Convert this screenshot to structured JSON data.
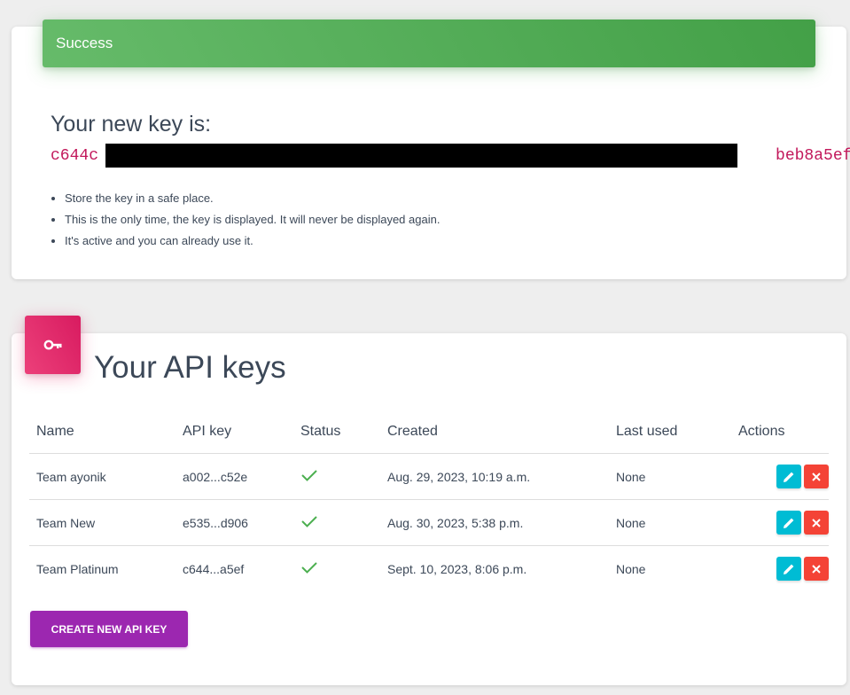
{
  "success": {
    "banner": "Success",
    "heading": "Your new key is:",
    "key_prefix": "c644c",
    "key_suffix": "beb8a5ef",
    "notes": [
      "Store the key in a safe place.",
      "This is the only time, the key is displayed. It will never be displayed again.",
      "It's active and you can already use it."
    ]
  },
  "keys": {
    "title": "Your API keys",
    "icon": "key-icon",
    "columns": [
      "Name",
      "API key",
      "Status",
      "Created",
      "Last used",
      "Actions"
    ],
    "rows": [
      {
        "name": "Team ayonik",
        "key": "a002...c52e",
        "status": "active",
        "created": "Aug. 29, 2023, 10:19 a.m.",
        "last_used": "None"
      },
      {
        "name": "Team New",
        "key": "e535...d906",
        "status": "active",
        "created": "Aug. 30, 2023, 5:38 p.m.",
        "last_used": "None"
      },
      {
        "name": "Team Platinum",
        "key": "c644...a5ef",
        "status": "active",
        "created": "Sept. 10, 2023, 8:06 p.m.",
        "last_used": "None"
      }
    ],
    "create_button": "CREATE NEW API KEY"
  },
  "colors": {
    "success": "#4caf50",
    "key_icon_bg": "#e91e63",
    "edit": "#00bcd4",
    "delete": "#f44336",
    "create": "#9c27b0",
    "check": "#4caf50"
  }
}
